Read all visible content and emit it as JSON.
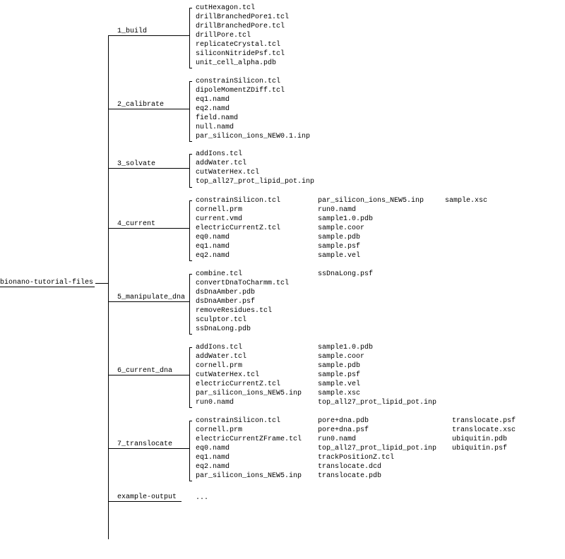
{
  "root": "bionano-tutorial-files",
  "dirs": {
    "d1": {
      "label": "1_build",
      "cols": [
        [
          "cutHexagon.tcl",
          "drillBranchedPore1.tcl",
          "drillBranchedPore.tcl",
          "drillPore.tcl",
          "replicateCrystal.tcl",
          "siliconNitridePsf.tcl",
          "unit_cell_alpha.pdb"
        ]
      ]
    },
    "d2": {
      "label": "2_calibrate",
      "cols": [
        [
          "constrainSilicon.tcl",
          "dipoleMomentZDiff.tcl",
          "eq1.namd",
          "eq2.namd",
          "field.namd",
          "null.namd",
          "par_silicon_ions_NEW0.1.inp"
        ]
      ]
    },
    "d3": {
      "label": "3_solvate",
      "cols": [
        [
          "addIons.tcl",
          "addWater.tcl",
          "cutWaterHex.tcl",
          "top_all27_prot_lipid_pot.inp"
        ]
      ]
    },
    "d4": {
      "label": "4_current",
      "cols": [
        [
          "constrainSilicon.tcl",
          "cornell.prm",
          "current.vmd",
          "electricCurrentZ.tcl",
          "eq0.namd",
          "eq1.namd",
          "eq2.namd"
        ],
        [
          "par_silicon_ions_NEW5.inp",
          "run0.namd",
          "sample1.0.pdb",
          "sample.coor",
          "sample.pdb",
          "sample.psf",
          "sample.vel"
        ],
        [
          "sample.xsc"
        ]
      ]
    },
    "d5": {
      "label": "5_manipulate_dna",
      "cols": [
        [
          "combine.tcl",
          "convertDnaToCharmm.tcl",
          "dsDnaAmber.pdb",
          "dsDnaAmber.psf",
          "removeResidues.tcl",
          "sculptor.tcl",
          "ssDnaLong.pdb"
        ],
        [
          "ssDnaLong.psf"
        ]
      ]
    },
    "d6": {
      "label": "6_current_dna",
      "cols": [
        [
          "addIons.tcl",
          "addWater.tcl",
          "cornell.prm",
          "cutWaterHex.tcl",
          "electricCurrentZ.tcl",
          "par_silicon_ions_NEW5.inp",
          "run0.namd"
        ],
        [
          "sample1.0.pdb",
          "sample.coor",
          "sample.pdb",
          "sample.psf",
          "sample.vel",
          "sample.xsc",
          "top_all27_prot_lipid_pot.inp"
        ]
      ]
    },
    "d7": {
      "label": "7_translocate",
      "cols": [
        [
          "constrainSilicon.tcl",
          "cornell.prm",
          "electricCurrentZFrame.tcl",
          "eq0.namd",
          "eq1.namd",
          "eq2.namd",
          "par_silicon_ions_NEW5.inp"
        ],
        [
          "pore+dna.pdb",
          "pore+dna.psf",
          "run0.namd",
          "top_all27_prot_lipid_pot.inp",
          "trackPositionZ.tcl",
          "translocate.dcd",
          "translocate.pdb"
        ],
        [
          "translocate.psf",
          "translocate.xsc",
          "ubiquitin.pdb",
          "ubiquitin.psf"
        ]
      ]
    },
    "d8": {
      "label": "example-output",
      "cols": [
        [
          "..."
        ]
      ]
    }
  }
}
